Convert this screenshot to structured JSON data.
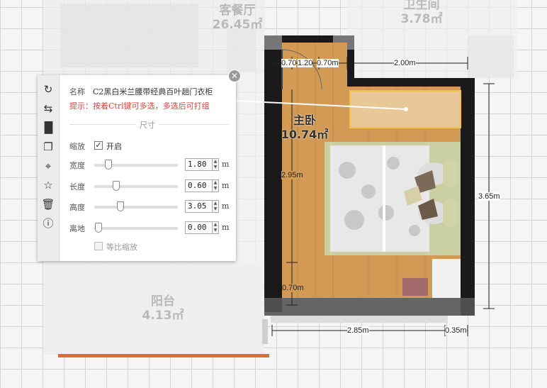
{
  "rooms": {
    "living": {
      "name": "客餐厅",
      "area": "26.45㎡"
    },
    "bath": {
      "name": "卫生间",
      "area": "3.78㎡"
    },
    "balcony": {
      "name": "阳台",
      "area": "4.13㎡"
    },
    "bedroom": {
      "name": "主卧",
      "area": "10.74㎡"
    }
  },
  "dimensions": {
    "d1": "0.70",
    "d2": "1.20",
    "d3": "0.70m",
    "d4": "2.00m",
    "d5": "2.95m",
    "d6": "3.65m",
    "d7": "0.70m",
    "d8": "2.85m",
    "d9": "0.35m"
  },
  "panel": {
    "toolbar": [
      "rotate-icon",
      "swap-icon",
      "split-icon",
      "copy-icon",
      "snap-icon",
      "favorite-icon",
      "delete-icon",
      "info-icon"
    ],
    "name_label": "名称",
    "name_value": "C2黑白米兰腰带经典百叶趟门衣柜",
    "hint": "提示：按着Ctrl键可多选，多选后可打组",
    "section_title": "尺寸",
    "scale_label": "缩放",
    "scale_toggle_label": "开启",
    "scale_enabled": true,
    "fields": [
      {
        "label": "宽度",
        "value": "1.80",
        "unit": "m"
      },
      {
        "label": "长度",
        "value": "0.60",
        "unit": "m"
      },
      {
        "label": "高度",
        "value": "3.05",
        "unit": "m"
      },
      {
        "label": "离地",
        "value": "0.00",
        "unit": "m"
      }
    ],
    "proportional_label": "等比缩放",
    "proportional_enabled": false
  },
  "colors": {
    "wall": "#1a1a1a",
    "floor": "#d39a55",
    "selection": "#f2c14e",
    "hint": "#e0413b"
  }
}
